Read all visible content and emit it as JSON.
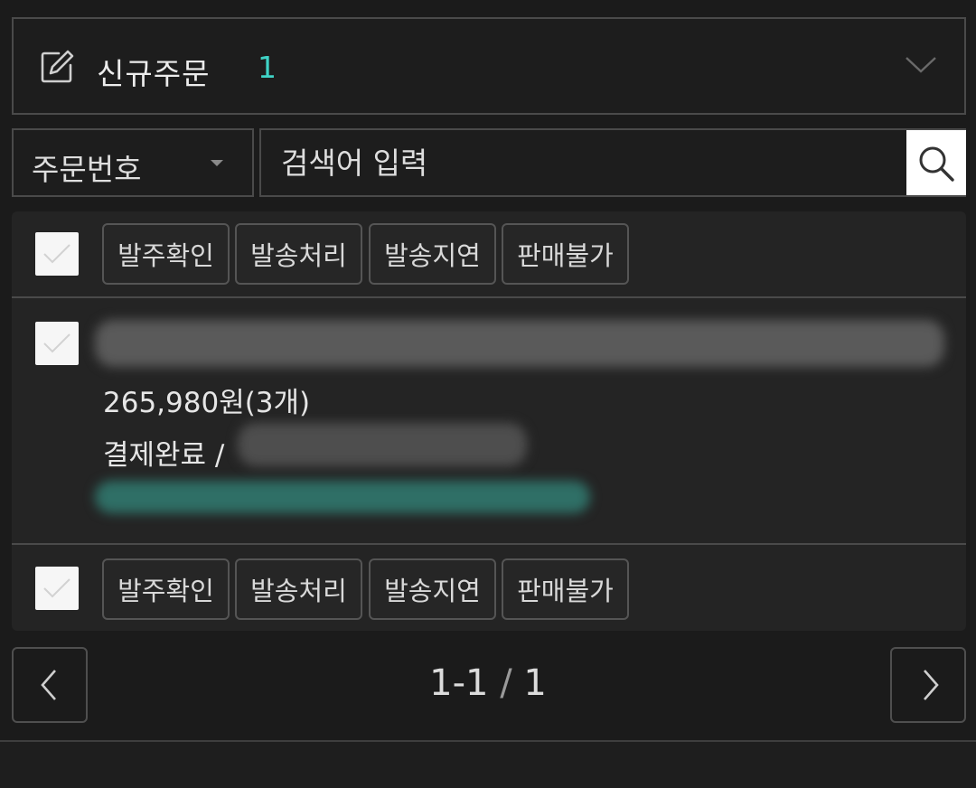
{
  "header": {
    "title": "신규주문",
    "count": "1"
  },
  "search": {
    "field_selected": "주문번호",
    "placeholder": "검색어 입력"
  },
  "actions": {
    "confirm": "발주확인",
    "ship": "발송처리",
    "delay": "발송지연",
    "unavailable": "판매불가"
  },
  "order": {
    "price": "265,980원(3개)",
    "status": "결제완료 /"
  },
  "pagination": {
    "range": "1-1",
    "separator": "/",
    "total": "1"
  },
  "colors": {
    "accent": "#3fd3c6",
    "background": "#1b1b1b",
    "card": "#242424"
  }
}
